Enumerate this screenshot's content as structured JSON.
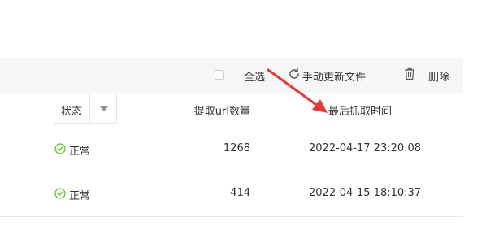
{
  "toolbar": {
    "select_all_label": "全选",
    "refresh_label": "手动更新文件",
    "delete_label": "删除"
  },
  "table": {
    "status_filter_label": "状态",
    "columns": {
      "count": "提取url数量",
      "time": "最后抓取时间"
    },
    "rows": [
      {
        "status": "正常",
        "count": "1268",
        "time": "2022-04-17 23:20:08"
      },
      {
        "status": "正常",
        "count": "414",
        "time": "2022-04-15 18:10:37"
      }
    ]
  },
  "colors": {
    "arrow": "#e53935",
    "status_ok": "#52c41a",
    "toolbar_bg": "#f5f6f8"
  },
  "icons": [
    "checkbox",
    "refresh-icon",
    "trash-icon",
    "chevron-down-icon",
    "check-circle-icon"
  ]
}
